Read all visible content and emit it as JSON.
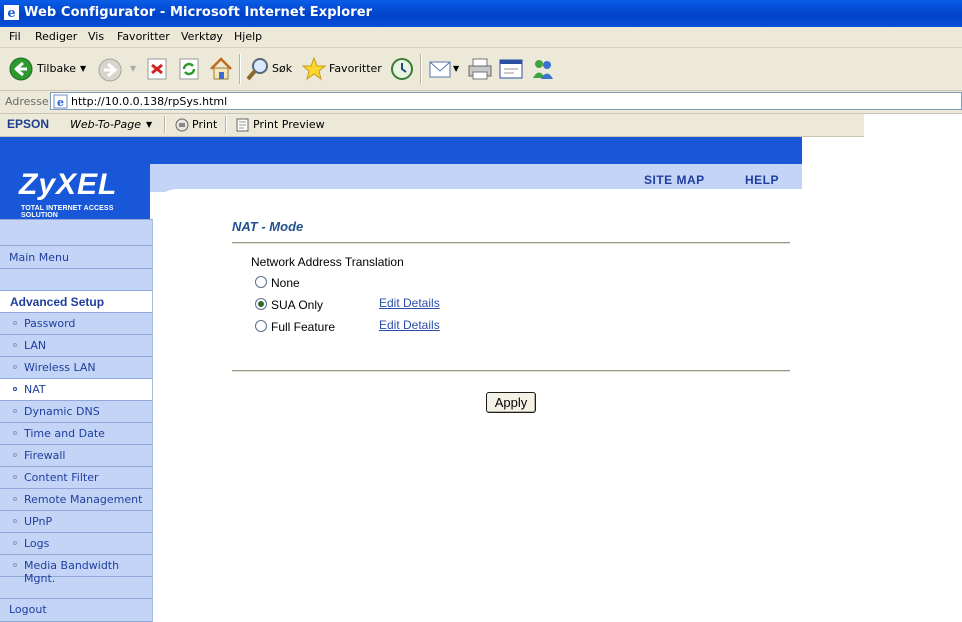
{
  "window": {
    "title": "Web Configurator - Microsoft Internet Explorer"
  },
  "menu": [
    "Fil",
    "Rediger",
    "Vis",
    "Favoritter",
    "Verktøy",
    "Hjelp"
  ],
  "toolbar": {
    "back": "Tilbake",
    "search": "Søk",
    "favorites": "Favoritter"
  },
  "address": {
    "label": "Adresse",
    "url": "http://10.0.0.138/rpSys.html"
  },
  "epson": {
    "brand": "EPSON",
    "webtopage": "Web-To-Page",
    "print": "Print",
    "preview": "Print Preview"
  },
  "header": {
    "logo": "ZyXEL",
    "tagline": "Total Internet Access Solution",
    "sitemap": "SITE MAP",
    "help": "HELP"
  },
  "sidebar": {
    "main_menu": "Main Menu",
    "advanced_setup": "Advanced Setup",
    "items": [
      "Password",
      "LAN",
      "Wireless LAN",
      "NAT",
      "Dynamic DNS",
      "Time and Date",
      "Firewall",
      "Content Filter",
      "Remote Management",
      "UPnP",
      "Logs",
      "Media Bandwidth Mgnt."
    ],
    "active": "NAT",
    "logout": "Logout"
  },
  "main": {
    "title": "NAT - Mode",
    "group_label": "Network Address Translation",
    "options": [
      {
        "label": "None",
        "checked": false
      },
      {
        "label": "SUA Only",
        "checked": true,
        "link": "Edit Details"
      },
      {
        "label": "Full Feature",
        "checked": false,
        "link": "Edit Details"
      }
    ],
    "apply": "Apply"
  },
  "colors": {
    "brand_blue": "#1858d8",
    "sidebar_bg": "#c4d4f6",
    "link": "#2b4fa8"
  }
}
